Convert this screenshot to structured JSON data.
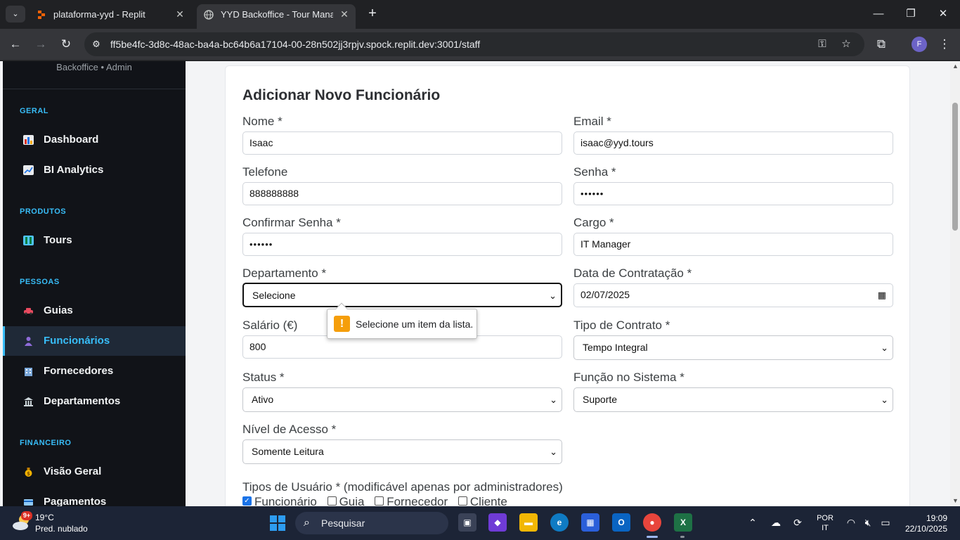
{
  "browser": {
    "tabs": [
      {
        "title": "plataforma-yyd - Replit",
        "active": false
      },
      {
        "title": "YYD Backoffice - Tour Managem",
        "active": true
      }
    ],
    "url": "ff5be4fc-3d8c-48ac-ba4a-bc64b6a17104-00-28n502jj3rpjv.spock.replit.dev:3001/staff",
    "profile_initial": "F"
  },
  "sidebar": {
    "subtitle": "Backoffice • Admin",
    "sections": [
      {
        "title": "GERAL",
        "items": [
          {
            "label": "Dashboard",
            "icon": "bar-chart-icon"
          },
          {
            "label": "BI Analytics",
            "icon": "line-chart-icon"
          }
        ]
      },
      {
        "title": "PRODUTOS",
        "items": [
          {
            "label": "Tours",
            "icon": "map-icon"
          }
        ]
      },
      {
        "title": "PESSOAS",
        "items": [
          {
            "label": "Guias",
            "icon": "car-icon"
          },
          {
            "label": "Funcionários",
            "icon": "person-icon",
            "active": true
          },
          {
            "label": "Fornecedores",
            "icon": "building-icon"
          },
          {
            "label": "Departamentos",
            "icon": "bank-icon"
          }
        ]
      },
      {
        "title": "FINANCEIRO",
        "items": [
          {
            "label": "Visão Geral",
            "icon": "money-bag-icon"
          },
          {
            "label": "Pagamentos",
            "icon": "card-icon"
          }
        ]
      }
    ]
  },
  "form": {
    "title": "Adicionar Novo Funcionário",
    "fields": {
      "nome": {
        "label": "Nome *",
        "value": "Isaac"
      },
      "email": {
        "label": "Email *",
        "value": "isaac@yyd.tours"
      },
      "telefone": {
        "label": "Telefone",
        "value": "888888888"
      },
      "senha": {
        "label": "Senha *",
        "value": "••••••"
      },
      "confirmar_senha": {
        "label": "Confirmar Senha *",
        "value": "••••••"
      },
      "cargo": {
        "label": "Cargo *",
        "value": "IT Manager"
      },
      "departamento": {
        "label": "Departamento *",
        "value": "Selecione"
      },
      "data_contratacao": {
        "label": "Data de Contratação *",
        "value": "02/07/2025"
      },
      "salario": {
        "label": "Salário (€)",
        "value": "800"
      },
      "tipo_contrato": {
        "label": "Tipo de Contrato *",
        "value": "Tempo Integral"
      },
      "status": {
        "label": "Status *",
        "value": "Ativo"
      },
      "funcao_sistema": {
        "label": "Função no Sistema *",
        "value": "Suporte"
      },
      "nivel_acesso": {
        "label": "Nível de Acesso *",
        "value": "Somente Leitura"
      }
    },
    "validation_message": "Selecione um item da lista.",
    "user_types": {
      "label": "Tipos de Usuário * (modificável apenas por administradores)",
      "options": [
        {
          "label": "Funcionário",
          "checked": true
        },
        {
          "label": "Guia",
          "checked": false
        },
        {
          "label": "Fornecedor",
          "checked": false
        },
        {
          "label": "Cliente",
          "checked": false
        }
      ]
    }
  },
  "taskbar": {
    "weather_badge": "9+",
    "temperature": "19°C",
    "weather_desc": "Pred. nublado",
    "search_placeholder": "Pesquisar",
    "lang_line1": "POR",
    "lang_line2": "IT",
    "time": "19:09",
    "date": "22/10/2025"
  },
  "colors": {
    "accent": "#38bdf8",
    "sidebar_bg": "#111318",
    "warning": "#f59e0b"
  }
}
